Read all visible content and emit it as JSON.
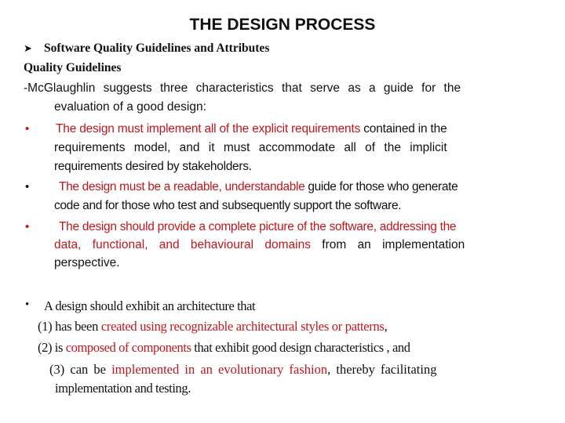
{
  "title": "THE DESIGN PROCESS",
  "section": {
    "arrow_icon": "arrow-bullet-icon",
    "heading": "Software Quality Guidelines and Attributes",
    "subheading": "Quality Guidelines",
    "intro_line1": "-McGlaughlin  suggests  three  characteristics  that  serve  as  a  guide  for  the",
    "intro_line2": "evaluation of a good design:"
  },
  "bullets": [
    {
      "bullet_color": "#c0161c",
      "lines": [
        {
          "red": "The design must implement all of the explicit requirements",
          "black": " contained in the"
        },
        {
          "black": "requirements  model,  and  it  must  accommodate  all  of  the  implicit"
        },
        {
          "black": "requirements desired by stakeholders."
        }
      ]
    },
    {
      "bullet_color": "#111111",
      "lines": [
        {
          "red": "The design must be a readable, understandable",
          "black": " guide for those who generate"
        },
        {
          "black": "code and for those who test and subsequently support the software."
        }
      ]
    },
    {
      "bullet_color": "#c0161c",
      "lines": [
        {
          "red": "The design should provide a complete picture of the software, addressing the"
        },
        {
          "red": "data,  functional,  and  behavioural  domains",
          "black": "  from  an  implementation"
        },
        {
          "black": "perspective."
        }
      ]
    }
  ],
  "architecture": {
    "bullet": "A design should exhibit an architecture that",
    "item1_prefix": "(1) has been ",
    "item1_red": "created using  recognizable  architectural  styles or patterns",
    "item1_suffix": ",",
    "item2_prefix": "(2) is ",
    "item2_red": "composed of components",
    "item2_suffix": " that exhibit good design characteristics , and",
    "item3_prefix": "(3)  can  be  ",
    "item3_red": "implemented  in  an  evolutionary  fashion",
    "item3_suffix": ",  thereby  facilitating",
    "item3_line2": "implementation and testing."
  }
}
